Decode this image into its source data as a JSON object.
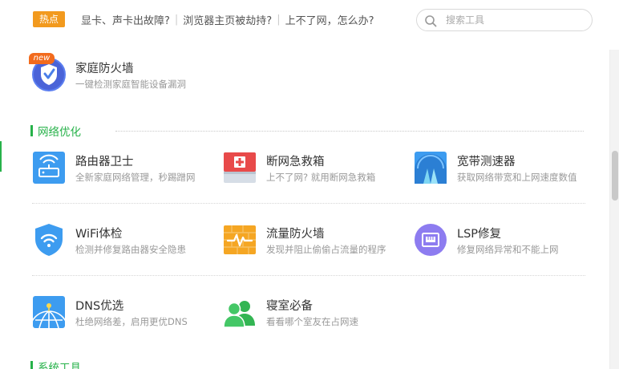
{
  "hot": {
    "badge": "热点",
    "links": [
      "显卡、声卡出故障?",
      "浏览器主页被劫持?",
      "上不了网，怎么办?"
    ]
  },
  "search": {
    "placeholder": "搜索工具",
    "icon": "search-icon"
  },
  "featured": {
    "tag": "new",
    "name": "家庭防火墙",
    "desc": "一键检测家庭智能设备漏洞",
    "icon": "shield-icon"
  },
  "sections": [
    {
      "title": "网络优化",
      "tools": [
        {
          "name": "路由器卫士",
          "desc": "全新家庭网络管理，秒踢蹭网",
          "icon": "router-icon"
        },
        {
          "name": "断网急救箱",
          "desc": "上不了网? 就用断网急救箱",
          "icon": "first-aid-kit-icon"
        },
        {
          "name": "宽带测速器",
          "desc": "获取网络带宽和上网速度数值",
          "icon": "speedometer-icon"
        },
        {
          "name": "WiFi体检",
          "desc": "检测并修复路由器安全隐患",
          "icon": "wifi-shield-icon"
        },
        {
          "name": "流量防火墙",
          "desc": "发现并阻止偷偷占流量的程序",
          "icon": "traffic-firewall-icon"
        },
        {
          "name": "LSP修复",
          "desc": "修复网络异常和不能上网",
          "icon": "network-port-icon"
        },
        {
          "name": "DNS优选",
          "desc": "杜绝网络差，启用更优DNS",
          "icon": "dns-globe-icon"
        },
        {
          "name": "寝室必备",
          "desc": "看看哪个室友在占网速",
          "icon": "roommates-icon"
        }
      ]
    },
    {
      "title": "系统工具"
    }
  ],
  "colors": {
    "accent_green": "#27b24a",
    "hot_orange": "#f29a1e",
    "icon_blue": "#3d9cf0",
    "icon_orange": "#f5a623",
    "icon_purple": "#8d7cf0",
    "icon_green": "#44c766",
    "icon_red": "#e84a4a"
  }
}
